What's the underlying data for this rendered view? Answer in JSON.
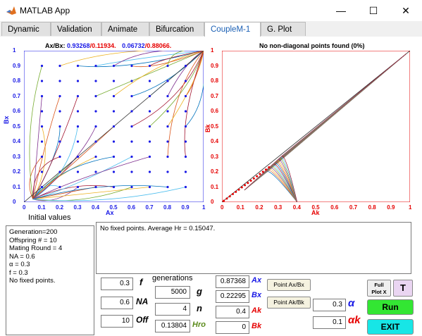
{
  "window": {
    "title": "MATLAB App",
    "minimize_glyph": "—",
    "maximize_glyph": "☐",
    "close_glyph": "✕"
  },
  "tabs": [
    {
      "label": "Dynamic"
    },
    {
      "label": "Validation"
    },
    {
      "label": "Animate"
    },
    {
      "label": "Bifurcation"
    },
    {
      "label": "CoupleM-1"
    },
    {
      "label": "G. Plot"
    }
  ],
  "active_tab": "CoupleM-1",
  "left_plot": {
    "title_prefix": "Ax/Bx:",
    "title_v1": "0.93268",
    "title_v2": "/0.11934.",
    "title_v3": "0.06732",
    "title_v4": "/0.88066.",
    "xlabel": "Ax",
    "ylabel": "Bx",
    "xticks": [
      "0",
      "0.1",
      "0.2",
      "0.3",
      "0.4",
      "0.5",
      "0.6",
      "0.7",
      "0.8",
      "0.9",
      "1"
    ],
    "yticks": [
      "0",
      "0.1",
      "0.2",
      "0.3",
      "0.4",
      "0.5",
      "0.6",
      "0.7",
      "0.8",
      "0.9",
      "1"
    ],
    "below_label": "Initial values"
  },
  "right_plot": {
    "title": "No non-diagonal points found (0%)",
    "xlabel": "Ak",
    "ylabel": "Bk",
    "xticks": [
      "0",
      "0.1",
      "0.2",
      "0.3",
      "0.4",
      "0.5",
      "0.6",
      "0.7",
      "0.8",
      "0.9",
      "1"
    ],
    "yticks": [
      "0",
      "0.1",
      "0.2",
      "0.3",
      "0.4",
      "0.5",
      "0.6",
      "0.7",
      "0.8",
      "0.9",
      "1"
    ]
  },
  "info_box": {
    "lines": [
      "Generation=200",
      "Offspring # = 10",
      "Mating Round = 4",
      "NA = 0.6",
      "α = 0.3",
      "f = 0.3",
      "No fixed points."
    ]
  },
  "message_box": {
    "text": "No fixed points.  Average Hr = 0.15047."
  },
  "params": {
    "f_value": "0.3",
    "f_label": "f",
    "na_value": "0.6",
    "na_label": "NA",
    "off_value": "10",
    "off_label": "Off",
    "generations_label": "generations",
    "g_value": "5000",
    "g_label": "g",
    "n_value": "4",
    "n_label": "n",
    "hro_value": "0.13804",
    "hro_label": "Hro",
    "ax_value": "0.87368",
    "ax_label": "Ax",
    "bx_value": "0.22295",
    "bx_label": "Bx",
    "ak_value": "0.4",
    "ak_label": "Ak",
    "bk_value": "0",
    "bk_label": "Bk",
    "alpha_value": "0.3",
    "alpha_label": "α",
    "alphak_value": "0.1",
    "alphak_label": "αk"
  },
  "buttons": {
    "point_axbx": "Point Ax/Bx",
    "point_akbk": "Point Ak/Bk",
    "full_plot_line1": "Full",
    "full_plot_line2": "Plot X",
    "t": "T",
    "run": "Run",
    "exit": "EXIT"
  },
  "colors": {
    "blue_axis": "#1a1ae6",
    "red_axis": "#e60000",
    "run_green": "#33e633",
    "exit_cyan": "#17e6e6",
    "tab_active_text": "#1a5fb4",
    "hro_color": "#5a8a1a"
  },
  "icons": {
    "app": "matlab-icon"
  }
}
